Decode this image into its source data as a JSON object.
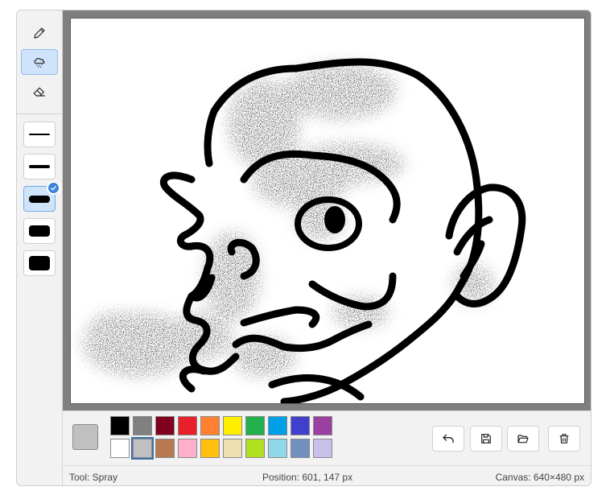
{
  "toolbar": {
    "tools": [
      {
        "id": "pencil",
        "icon": "pencil-icon",
        "active": false
      },
      {
        "id": "spray",
        "icon": "spray-cloud-icon",
        "active": true
      },
      {
        "id": "eraser",
        "icon": "eraser-icon",
        "active": false
      }
    ],
    "sizes": [
      {
        "id": "size-1",
        "active": false
      },
      {
        "id": "size-2",
        "active": false
      },
      {
        "id": "size-3",
        "active": true
      },
      {
        "id": "size-4",
        "active": false
      },
      {
        "id": "size-5",
        "active": false
      }
    ]
  },
  "current_color": "#c0c0c0",
  "palette": {
    "row1": [
      "#000000",
      "#808080",
      "#800020",
      "#e8202a",
      "#ff8030",
      "#ffee00",
      "#22b04c",
      "#00a0e8",
      "#4040cc",
      "#9a40a0"
    ],
    "row2": [
      "#ffffff",
      "#c0c0c0",
      "#b87850",
      "#ffb0cc",
      "#ffc010",
      "#f0e0b0",
      "#b0e020",
      "#90d8e8",
      "#7090c0",
      "#c8c0e8"
    ],
    "selected": "#c0c0c0"
  },
  "actions": [
    {
      "id": "undo",
      "icon": "undo-icon"
    },
    {
      "id": "save",
      "icon": "save-icon"
    },
    {
      "id": "open",
      "icon": "folder-open-icon"
    },
    {
      "id": "clear",
      "icon": "trash-icon"
    }
  ],
  "status": {
    "tool": "Tool: Spray",
    "position": "Position: 601, 147 px",
    "canvas": "Canvas: 640×480 px"
  }
}
